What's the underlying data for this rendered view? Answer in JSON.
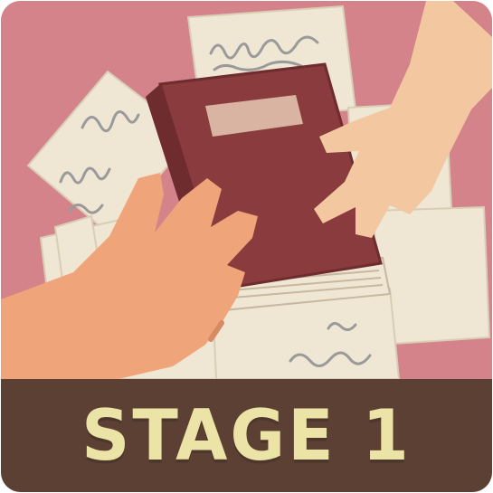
{
  "level_card": {
    "stage_label": "STAGE 1",
    "illustration": "hands-passing-book"
  },
  "colors": {
    "background": "#d4838a",
    "banner": "#5b4033",
    "label_text": "#ece3a7",
    "book_cover": "#8a3b3e",
    "paper": "#efe6d4",
    "skin": "#f0a47a"
  }
}
